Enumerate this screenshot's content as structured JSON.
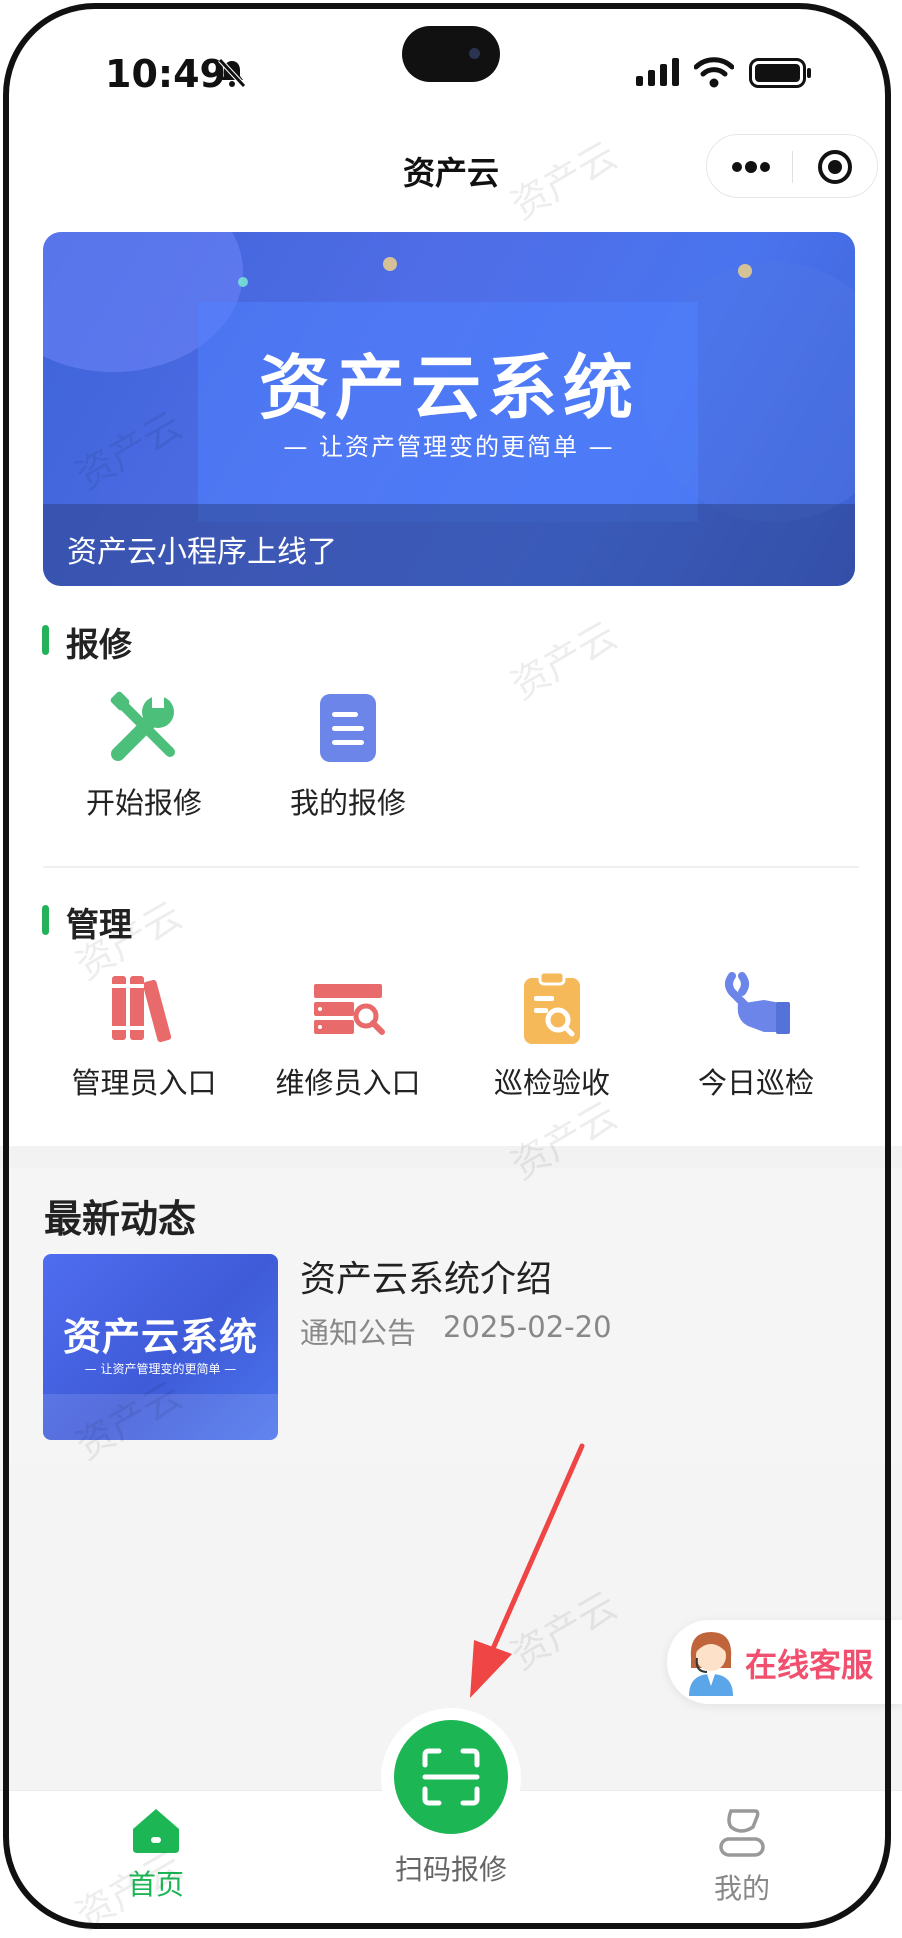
{
  "status_bar": {
    "time": "10:49"
  },
  "nav": {
    "title": "资产云"
  },
  "banner": {
    "title": "资产云系统",
    "subtitle": "— 让资产管理变的更简单 —",
    "caption": "资产云小程序上线了"
  },
  "repair": {
    "title": "报修",
    "items": [
      {
        "label": "开始报修",
        "icon": "wrench-screwdriver-icon",
        "color": "#4cbf7a"
      },
      {
        "label": "我的报修",
        "icon": "document-icon",
        "color": "#6b86e8"
      }
    ]
  },
  "manage": {
    "title": "管理",
    "items": [
      {
        "label": "管理员入口",
        "icon": "books-icon",
        "color": "#e86a6a"
      },
      {
        "label": "维修员入口",
        "icon": "server-search-icon",
        "color": "#e86a6a"
      },
      {
        "label": "巡检验收",
        "icon": "clipboard-search-icon",
        "color": "#f5b95a"
      },
      {
        "label": "今日巡检",
        "icon": "hand-wrench-icon",
        "color": "#6b86e8"
      }
    ]
  },
  "news": {
    "title": "最新动态",
    "items": [
      {
        "thumb_title": "资产云系统",
        "thumb_subtitle": "— 让资产管理变的更简单 —",
        "title": "资产云系统介绍",
        "category": "通知公告",
        "date": "2025-02-20"
      }
    ]
  },
  "customer_service": {
    "label": "在线客服"
  },
  "tabbar": {
    "items": [
      {
        "label": "首页",
        "icon": "home-icon",
        "active": true
      },
      {
        "label": "扫码报修",
        "icon": "scan-icon",
        "active": false
      },
      {
        "label": "我的",
        "icon": "profile-icon",
        "active": false
      }
    ]
  },
  "watermark": "资产云",
  "colors": {
    "accent": "#22b35a",
    "cs": "#f0506e",
    "banner": "#4a6ee8"
  }
}
